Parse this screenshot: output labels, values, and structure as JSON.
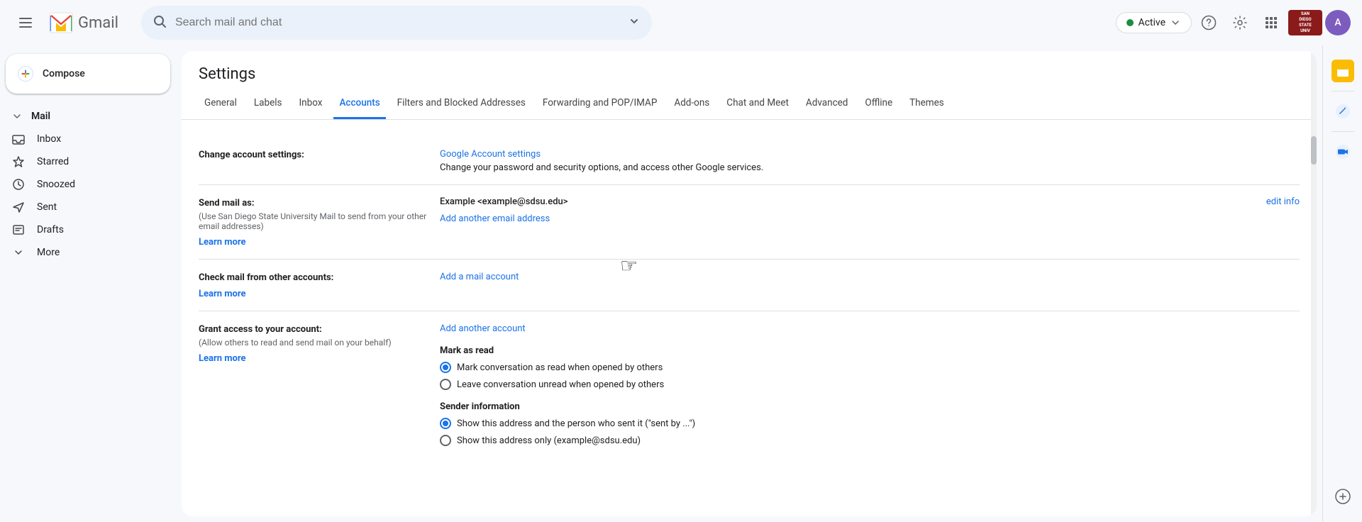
{
  "topbar": {
    "search_placeholder": "Search mail and chat",
    "active_label": "Active",
    "help_icon": "help-circle-icon",
    "settings_icon": "gear-icon",
    "apps_icon": "grid-icon",
    "university_logo": "SAN DIEGO STATE UNIVERSITY",
    "avatar_initials": "A"
  },
  "sidebar": {
    "compose_label": "Compose",
    "mail_section_label": "Mail",
    "nav_items": [
      {
        "label": "Inbox",
        "icon": "inbox-icon"
      },
      {
        "label": "Starred",
        "icon": "star-icon"
      },
      {
        "label": "Snoozed",
        "icon": "clock-icon"
      },
      {
        "label": "Sent",
        "icon": "send-icon"
      },
      {
        "label": "Drafts",
        "icon": "drafts-icon"
      },
      {
        "label": "More",
        "icon": "chevron-down-icon"
      }
    ]
  },
  "settings": {
    "title": "Settings",
    "tabs": [
      {
        "label": "General",
        "active": false
      },
      {
        "label": "Labels",
        "active": false
      },
      {
        "label": "Inbox",
        "active": false
      },
      {
        "label": "Accounts",
        "active": true
      },
      {
        "label": "Filters and Blocked Addresses",
        "active": false
      },
      {
        "label": "Forwarding and POP/IMAP",
        "active": false
      },
      {
        "label": "Add-ons",
        "active": false
      },
      {
        "label": "Chat and Meet",
        "active": false
      },
      {
        "label": "Advanced",
        "active": false
      },
      {
        "label": "Offline",
        "active": false
      },
      {
        "label": "Themes",
        "active": false
      }
    ],
    "rows": [
      {
        "id": "change-account",
        "label": "Change account settings:",
        "link_text": "Google Account settings",
        "desc": "Change your password and security options, and access other Google services."
      },
      {
        "id": "send-mail-as",
        "label": "Send mail as:",
        "sub_label": "(Use San Diego State University Mail to send from your other email addresses)",
        "learn_more": "Learn more",
        "email": "Example <example@sdsu.edu>",
        "edit_label": "edit info",
        "add_address": "Add another email address"
      },
      {
        "id": "check-mail",
        "label": "Check mail from other accounts:",
        "learn_more": "Learn more",
        "add_mail": "Add a mail account"
      },
      {
        "id": "grant-access",
        "label": "Grant access to your account:",
        "sub_label": "(Allow others to read and send mail on your behalf)",
        "learn_more": "Learn more",
        "add_account": "Add another account",
        "mark_as_read_heading": "Mark as read",
        "radio_options": [
          {
            "label": "Mark conversation as read when opened by others",
            "selected": true
          },
          {
            "label": "Leave conversation unread when opened by others",
            "selected": false
          }
        ],
        "sender_info_heading": "Sender information",
        "sender_radio_options": [
          {
            "label": "Show this address and the person who sent it (\"sent by ...\")",
            "selected": true
          },
          {
            "label": "Show this address only (example@sdsu.edu)",
            "selected": false
          }
        ]
      }
    ]
  },
  "right_sidebar": {
    "icons": [
      {
        "name": "calendar-icon",
        "color": "yellow"
      },
      {
        "name": "edit-blue-icon",
        "color": "blue"
      },
      {
        "name": "video-icon",
        "color": "blue"
      },
      {
        "name": "add-icon",
        "color": "gray"
      }
    ]
  }
}
